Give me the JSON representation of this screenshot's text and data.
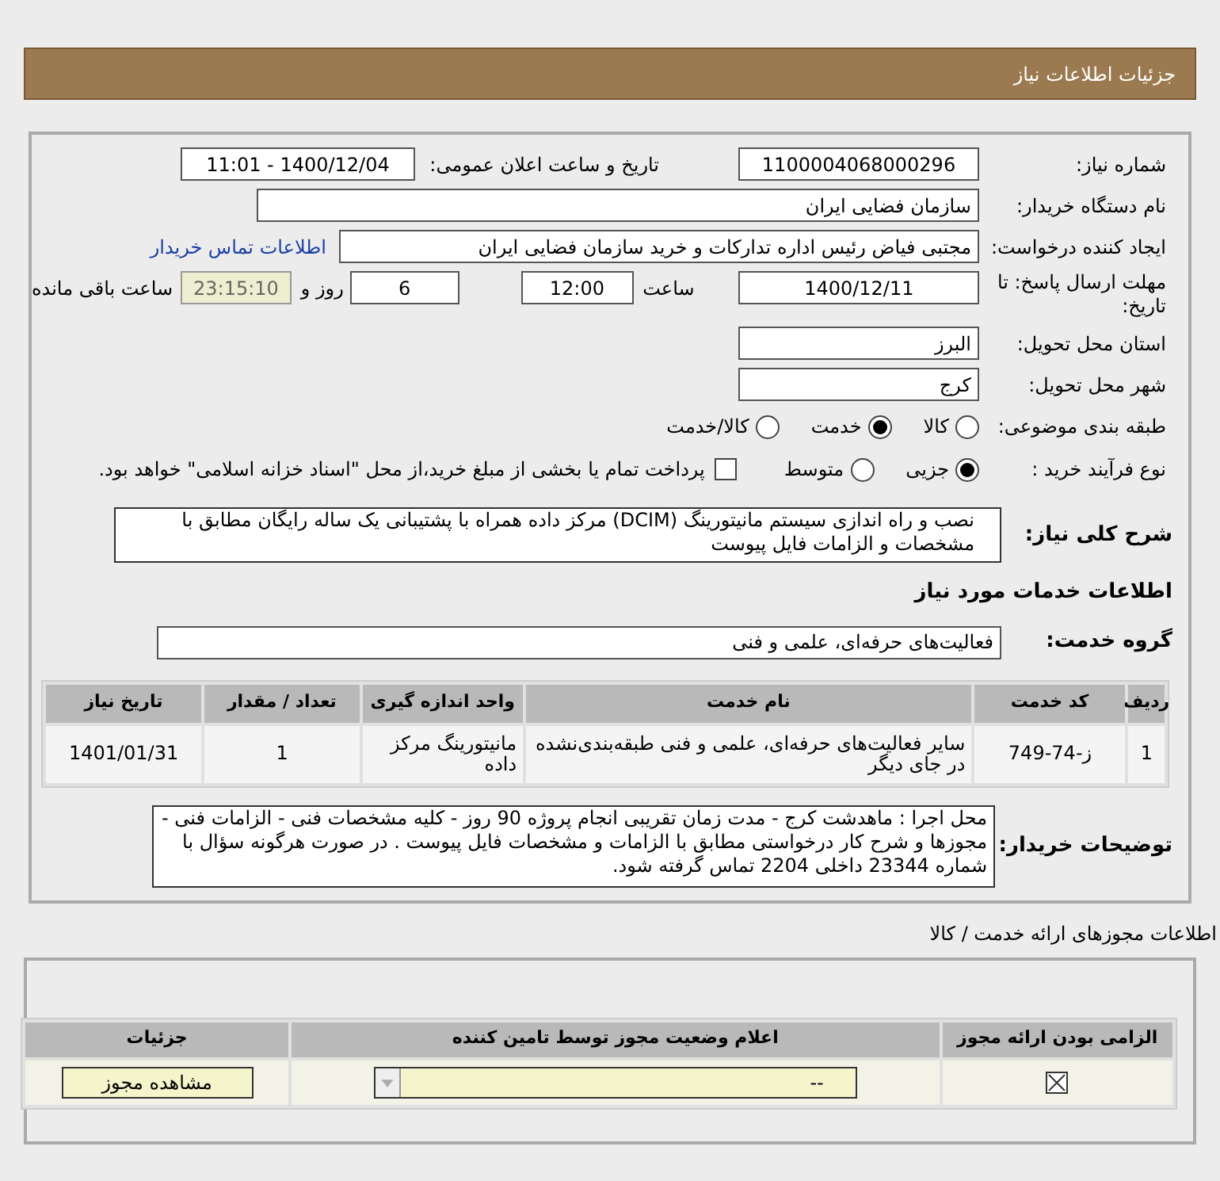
{
  "header": {
    "title": "جزئیات اطلاعات نیاز"
  },
  "need_number": {
    "label": "شماره نیاز:",
    "value": "1100004068000296"
  },
  "announce": {
    "label": "تاریخ و ساعت اعلان عمومی:",
    "value": "1400/12/04 - 11:01"
  },
  "buyer": {
    "label": "نام دستگاه خریدار:",
    "value": "سازمان فضایی ایران"
  },
  "requester": {
    "label": "ایجاد کننده درخواست:",
    "value": "مجتبی  فیاض رئیس اداره تدارکات و خرید سازمان فضایی ایران",
    "link": "اطلاعات تماس خریدار"
  },
  "deadline": {
    "label": "مهلت ارسال پاسخ: تا تاریخ:",
    "date": "1400/12/11",
    "time_label": "ساعت",
    "time": "12:00",
    "days": "6",
    "days_label": "روز و",
    "remaining": "23:15:10",
    "remaining_label": "ساعت باقی مانده"
  },
  "province": {
    "label": "استان محل تحویل:",
    "value": "البرز"
  },
  "city": {
    "label": "شهر محل تحویل:",
    "value": "کرج"
  },
  "category": {
    "label": "طبقه بندی موضوعی:",
    "options": [
      {
        "label": "کالا",
        "selected": false
      },
      {
        "label": "خدمت",
        "selected": true
      },
      {
        "label": "کالا/خدمت",
        "selected": false
      }
    ]
  },
  "process": {
    "label": "نوع فرآیند خرید :",
    "options": [
      {
        "label": "جزیی",
        "selected": true
      },
      {
        "label": "متوسط",
        "selected": false
      }
    ],
    "payment": {
      "checked": false,
      "label": "پرداخت تمام یا بخشی از مبلغ خرید،از محل \"اسناد خزانه اسلامی\" خواهد بود."
    }
  },
  "description": {
    "label": "شرح کلی نیاز:",
    "value": "نصب و راه اندازی سیستم مانیتورینگ  (DCIM) مرکز داده همراه با پشتیبانی یک ساله رایگان مطابق با مشخصات و الزامات فایل پیوست"
  },
  "services_title": "اطلاعات خدمات مورد نیاز",
  "service_group": {
    "label": "گروه خدمت:",
    "value": "فعالیت‌های حرفه‌ای، علمی و فنی"
  },
  "services_table": {
    "columns": [
      "ردیف",
      "کد خدمت",
      "نام خدمت",
      "واحد اندازه گیری",
      "تعداد / مقدار",
      "تاریخ نیاز"
    ],
    "rows": [
      [
        "1",
        "ز-74-749",
        "سایر فعالیت‌های حرفه‌ای، علمی و فنی طبقه‌بندی‌نشده در جای دیگر",
        "مانیتورینگ مرکز داده",
        "1",
        "1401/01/31"
      ]
    ]
  },
  "buyer_notes": {
    "label": "توضیحات خریدار:",
    "value": "محل اجرا : ماهدشت کرج - مدت زمان تقریبی انجام پروژه 90 روز - کلیه مشخصات فنی - الزامات فنی - مجوزها و شرح کار درخواستی مطابق با الزامات و مشخصات فایل پیوست . در صورت هرگونه سؤال با شماره 23344 داخلی 2204 تماس گرفته شود."
  },
  "permits": {
    "title": "اطلاعات مجوزهای ارائه خدمت / کالا",
    "columns": [
      "الزامی بودن ارائه مجوز",
      "اعلام وضعیت مجوز توسط تامین کننده",
      "جزئیات"
    ],
    "rows": [
      {
        "required": true,
        "status": "--",
        "action": "مشاهده مجوز"
      }
    ]
  }
}
